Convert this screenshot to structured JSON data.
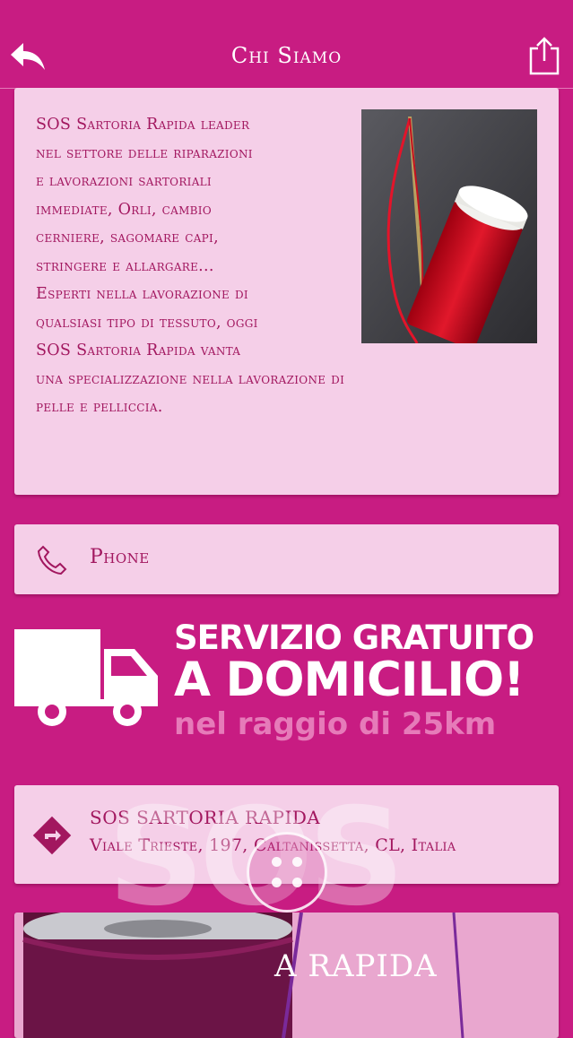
{
  "header": {
    "title": "Chi Siamo",
    "back_icon": "back-arrow-icon",
    "share_icon": "share-icon"
  },
  "about": {
    "lines": [
      "SOS Sartoria Rapida leader",
      "nel settore delle riparazioni",
      "e lavorazioni sartoriali",
      "immediate, Orli, cambio",
      "cerniere, sagomare capi,",
      "stringere e allargare...",
      "Esperti nella lavorazione di",
      "qualsiasi tipo di tessuto, oggi",
      "SOS Sartoria Rapida vanta",
      "una specializzazione nella lavorazione di",
      "pelle e pelliccia."
    ]
  },
  "phone": {
    "label": "Phone",
    "icon": "phone-icon"
  },
  "promo": {
    "line1": "SERVIZIO GRATUITO",
    "line2": "A DOMICILIO!",
    "line3": "nel raggio di 25km",
    "icon": "truck-icon"
  },
  "address": {
    "name": "SOS SARTORIA RAPIDA",
    "line": "Viale Trieste, 197, Caltanissetta, CL, Italia",
    "icon": "directions-icon"
  },
  "watermark": "SOS",
  "bottom": {
    "text": "A RAPIDA"
  },
  "colors": {
    "primary": "#C81C82",
    "card": "#F5CFE8",
    "text": "#A2175F"
  }
}
